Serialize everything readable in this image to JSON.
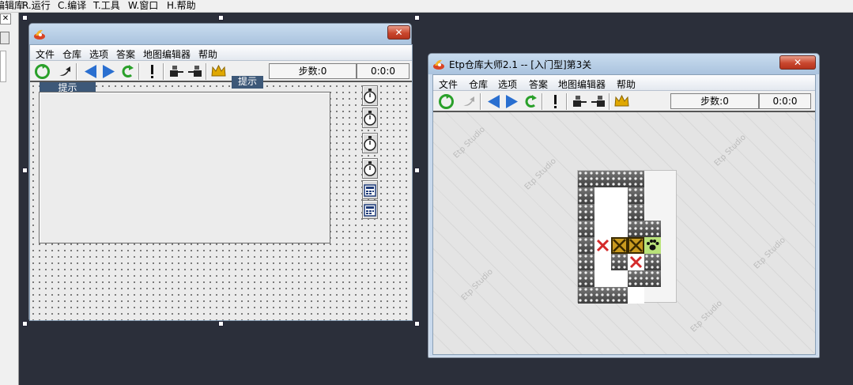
{
  "ide_menu": {
    "items": [
      "编辑库",
      "R.运行",
      "C.编译",
      "T.工具",
      "W.窗口",
      "H.帮助"
    ]
  },
  "design_window": {
    "menu": [
      "文件",
      "仓库",
      "选项",
      "答案",
      "地图编辑器",
      "帮助"
    ],
    "steps_label": "步数:0",
    "timer": "0:0:0",
    "tip_left": "提示",
    "tip_right": "提示",
    "close_glyph": "✕"
  },
  "game_window": {
    "title": "Etp仓库大师2.1 -- [入门型]第3关",
    "menu": [
      "文件",
      "仓库",
      "选项",
      "答案",
      "地图编辑器",
      "帮助"
    ],
    "steps_label": "步数:0",
    "timer": "0:0:0",
    "watermark_text": "Etp Studio",
    "close_glyph": "✕",
    "board": [
      "WWWW.",
      "WFFW.",
      "WFFW.",
      "WFFWW",
      "WTBBP",
      "WFWTW",
      "WFFWW",
      "WWWF."
    ]
  },
  "colors": {
    "desktop": "#2b2f3a",
    "titlebar": "#b7cde6",
    "close": "#c9472e",
    "tip": "#3d5878",
    "toolbar_green": "#2aa02a",
    "toolbar_blue": "#2a6fd0",
    "crown": "#e0a800"
  },
  "icons": {
    "ide_close": "close-icon",
    "design_side_buttons": [
      "stopwatch-icon",
      "stopwatch-icon",
      "stopwatch-icon",
      "stopwatch-icon",
      "calculator-icon",
      "calculator-icon"
    ],
    "toolbar": [
      "recycle-icon",
      "undo-arrow-icon",
      "back-triangle-icon",
      "forward-triangle-icon",
      "redo-arrow-icon",
      "exclamation-icon",
      "push-cart-icon",
      "pull-cart-icon",
      "crown-icon"
    ]
  }
}
